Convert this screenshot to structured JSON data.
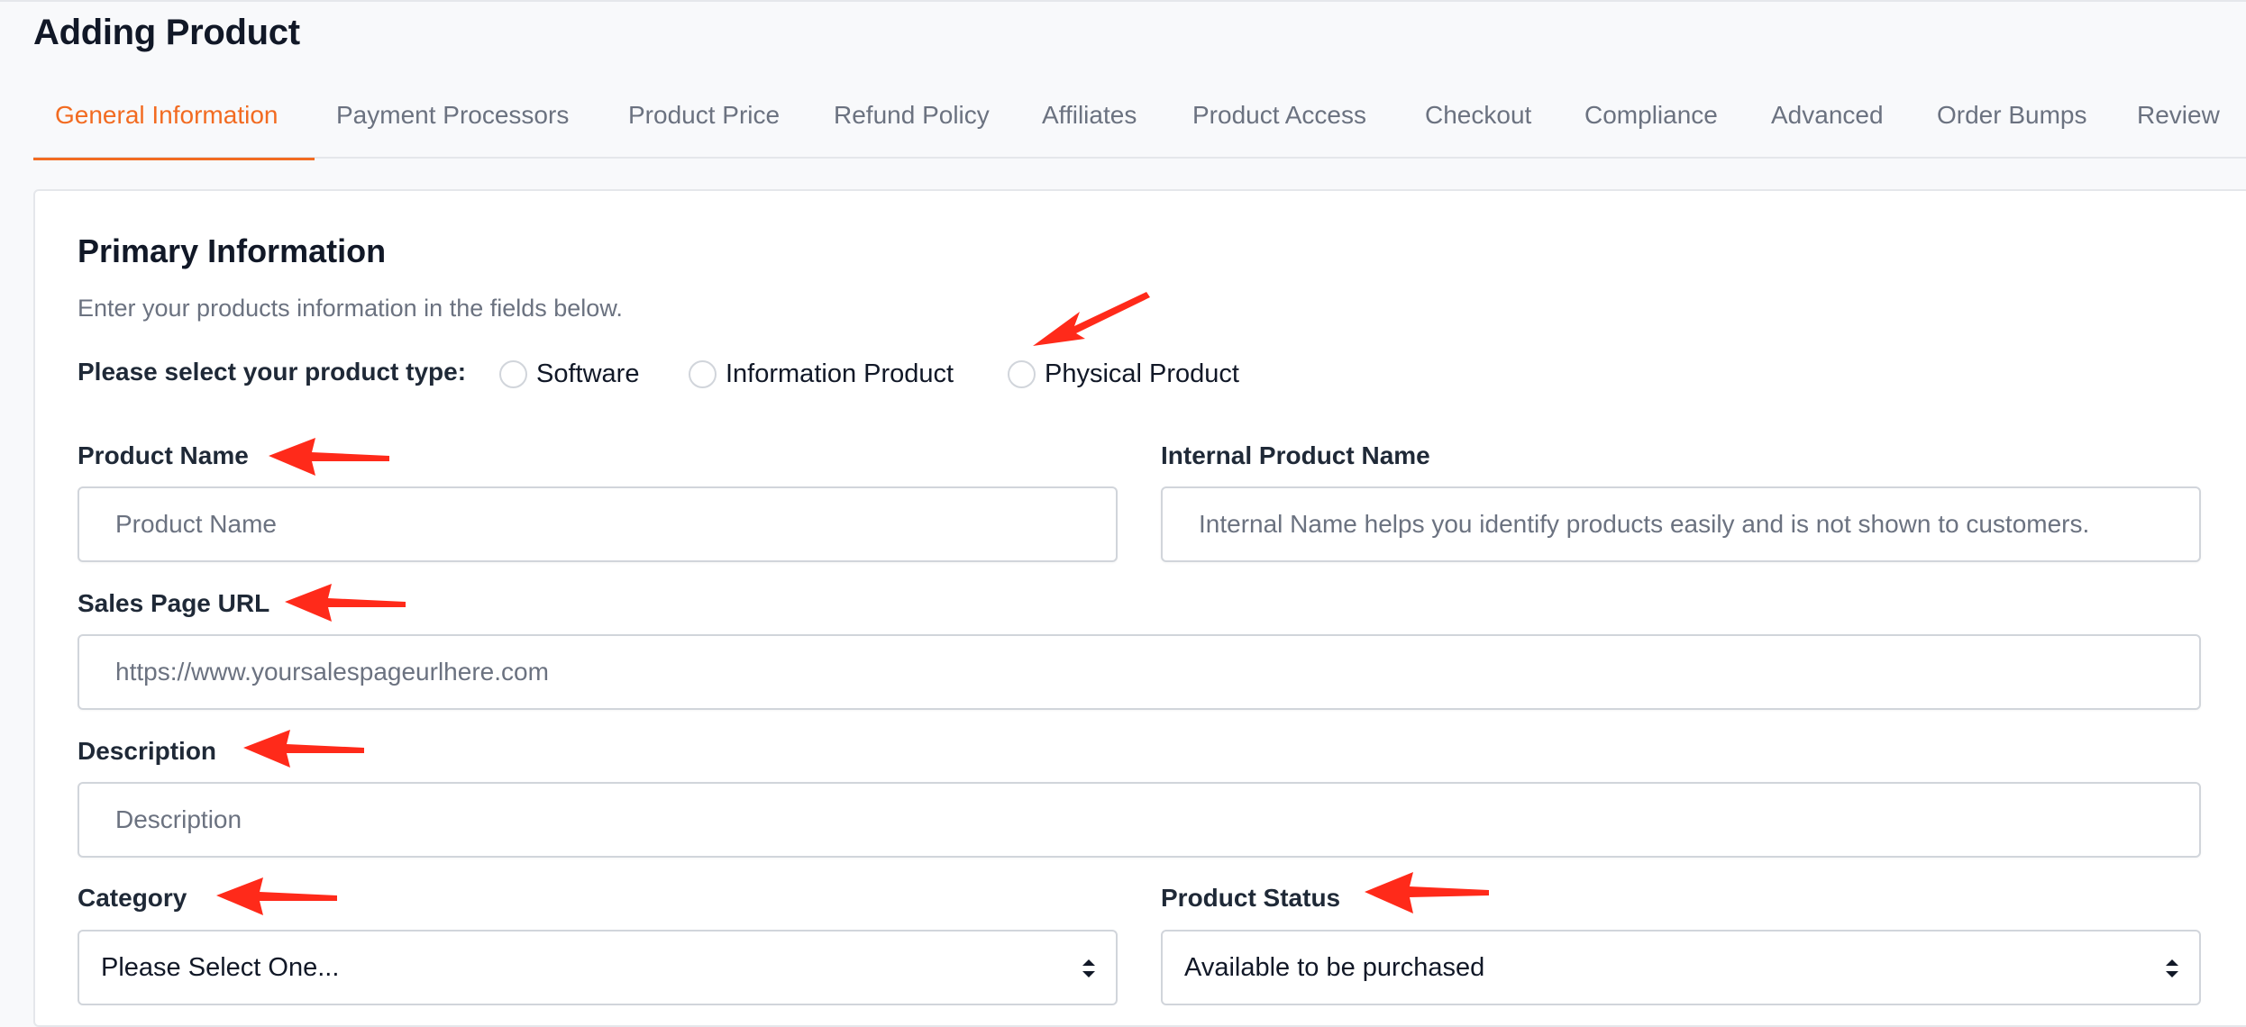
{
  "page": {
    "title": "Adding Product"
  },
  "tabs": [
    {
      "label": "General Information",
      "active": true
    },
    {
      "label": "Payment Processors",
      "active": false
    },
    {
      "label": "Product Price",
      "active": false
    },
    {
      "label": "Refund Policy",
      "active": false
    },
    {
      "label": "Affiliates",
      "active": false
    },
    {
      "label": "Product Access",
      "active": false
    },
    {
      "label": "Checkout",
      "active": false
    },
    {
      "label": "Compliance",
      "active": false
    },
    {
      "label": "Advanced",
      "active": false
    },
    {
      "label": "Order Bumps",
      "active": false
    },
    {
      "label": "Review",
      "active": false
    }
  ],
  "primary": {
    "title": "Primary Information",
    "subtitle": "Enter your products information in the fields below.",
    "type_label": "Please select your product type:",
    "types": [
      {
        "label": "Software",
        "checked": false
      },
      {
        "label": "Information Product",
        "checked": false
      },
      {
        "label": "Physical Product",
        "checked": false
      }
    ]
  },
  "fields": {
    "product_name": {
      "label": "Product Name",
      "placeholder": "Product Name"
    },
    "internal_name": {
      "label": "Internal Product Name",
      "placeholder": "Internal Name helps you identify products easily and is not shown to customers."
    },
    "sales_url": {
      "label": "Sales Page URL",
      "placeholder": "https://www.yoursalespageurlhere.com"
    },
    "description": {
      "label": "Description",
      "placeholder": "Description"
    },
    "category": {
      "label": "Category",
      "value": "Please Select One..."
    },
    "status": {
      "label": "Product Status",
      "value": "Available to be purchased"
    }
  },
  "colors": {
    "accent": "#f26b21",
    "annotation_arrow": "#ff2a1a",
    "muted_text": "#6b7280",
    "border": "#d1d5db"
  },
  "icons": {
    "select_chevron": "chevron-up-down-icon",
    "annotation": "red-arrow-annotation"
  }
}
